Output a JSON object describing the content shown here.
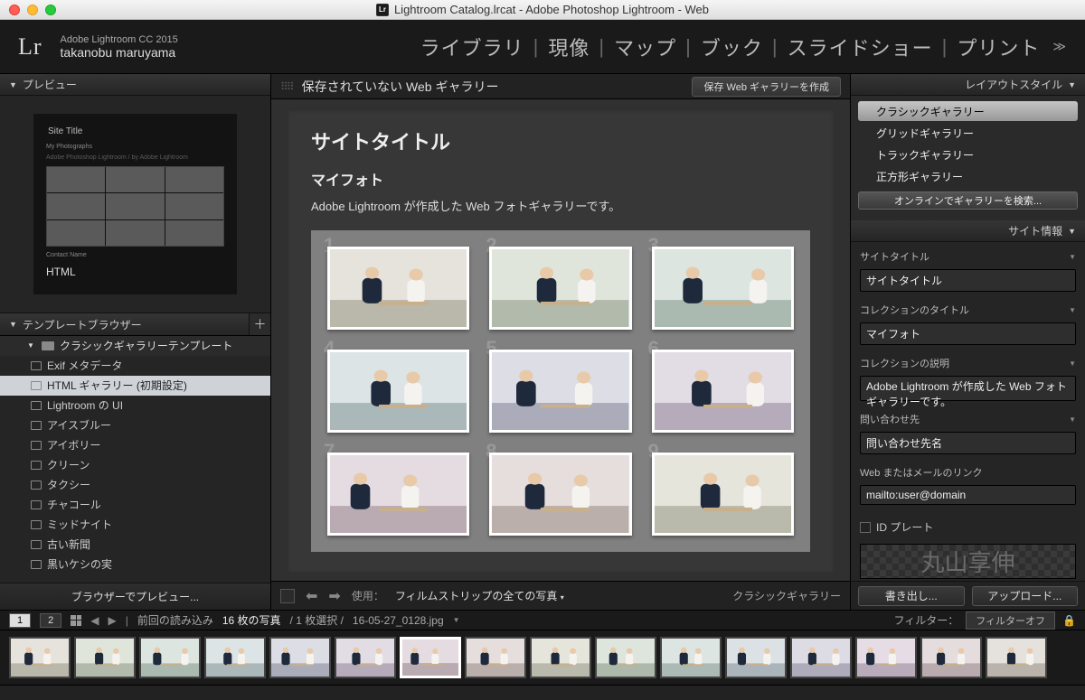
{
  "titlebar": "Lightroom Catalog.lrcat - Adobe Photoshop Lightroom - Web",
  "header": {
    "product": "Adobe Lightroom CC 2015",
    "user": "takanobu maruyama",
    "logo": "Lr",
    "modules": [
      "ライブラリ",
      "現像",
      "マップ",
      "ブック",
      "スライドショー",
      "プリント"
    ]
  },
  "left": {
    "preview_label": "プレビュー",
    "preview_site_title": "Site Title",
    "preview_sub1": "My Photographs",
    "preview_sub2": "Adobe Photoshop Lightroom / by Adobe Lightroom",
    "preview_contact": "Contact Name",
    "preview_type": "HTML",
    "template_browser": "テンプレートブラウザー",
    "group": "クラシックギャラリーテンプレート",
    "items": [
      "Exif メタデータ",
      "HTML ギャラリー (初期設定)",
      "Lightroom の UI",
      "アイスブルー",
      "アイボリー",
      "クリーン",
      "タクシー",
      "チャコール",
      "ミッドナイト",
      "古い新聞",
      "黒いケシの実"
    ],
    "selected_index": 1,
    "preview_button": "ブラウザーでプレビュー..."
  },
  "center": {
    "top_title": "保存されていない Web ギャラリー",
    "save_button": "保存 Web ギャラリーを作成",
    "site_title": "サイトタイトル",
    "collection_title": "マイフォト",
    "description": "Adobe Lightroom が作成した Web フォトギャラリーです。",
    "bottom_use_label": "使用：",
    "bottom_use_value": "フィルムストリップの全ての写真",
    "bottom_style": "クラシックギャラリー"
  },
  "right": {
    "layout_style_label": "レイアウトスタイル",
    "styles": [
      "クラシックギャラリー",
      "グリッドギャラリー",
      "トラックギャラリー",
      "正方形ギャラリー"
    ],
    "online_search": "オンラインでギャラリーを検索...",
    "site_info_label": "サイト情報",
    "site_title_label": "サイトタイトル",
    "site_title_value": "サイトタイトル",
    "collection_title_label": "コレクションのタイトル",
    "collection_title_value": "マイフォト",
    "collection_desc_label": "コレクションの説明",
    "collection_desc_value": "Adobe Lightroom が作成した Web フォトギャラリーです。",
    "contact_label": "問い合わせ先",
    "contact_value": "問い合わせ先名",
    "link_label": "Web またはメールのリンク",
    "link_value": "mailto:user@domain",
    "id_plate_label": "ID プレート",
    "id_plate_text": "丸山享伸",
    "export_button": "書き出し...",
    "upload_button": "アップロード..."
  },
  "filmstrip": {
    "prev_import": "前回の読み込み",
    "count": "16 枚の写真",
    "selected": "1 枚選択",
    "filename": "16-05-27_0128.jpg",
    "filter_label": "フィルター：",
    "filter_value": "フィルターオフ",
    "page1": "1",
    "page2": "2",
    "thumb_count": 16
  }
}
